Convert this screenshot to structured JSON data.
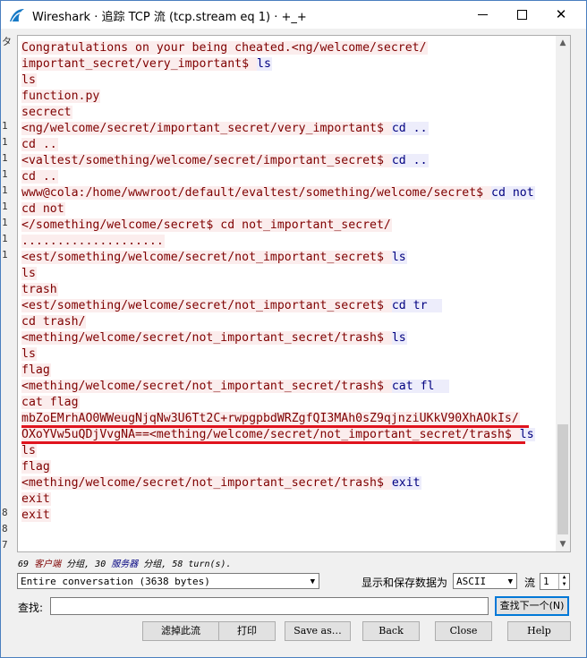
{
  "window": {
    "title": "Wireshark · 追踪 TCP 流 (tcp.stream eq 1) · +_+",
    "controls": {
      "minimize": "—",
      "maximize": "☐",
      "close": "✕"
    }
  },
  "left_strip": [
    "タ",
    "1",
    "1",
    "1",
    "1",
    "1",
    "1",
    "1",
    "1",
    "1",
    "8",
    "8",
    "7"
  ],
  "stream_lines": [
    [
      {
        "t": "Congratulations on your being cheated.<ng/welcome/secret/",
        "k": "c"
      }
    ],
    [
      {
        "t": "important_secret/very_important$ ",
        "k": "c"
      },
      {
        "t": "ls",
        "k": "s"
      }
    ],
    [
      {
        "t": "ls",
        "k": "c"
      }
    ],
    [
      {
        "t": "function.py",
        "k": "c"
      }
    ],
    [
      {
        "t": "secrect",
        "k": "c"
      }
    ],
    [
      {
        "t": "<ng/welcome/secret/important_secret/very_important$ ",
        "k": "c"
      },
      {
        "t": "cd ..",
        "k": "s"
      }
    ],
    [
      {
        "t": "cd ..",
        "k": "c"
      }
    ],
    [
      {
        "t": "<valtest/something/welcome/secret/important_secret$ ",
        "k": "c"
      },
      {
        "t": "cd ..",
        "k": "s"
      }
    ],
    [
      {
        "t": "cd ..",
        "k": "c"
      }
    ],
    [
      {
        "t": "www@cola:/home/wwwroot/default/evaltest/something/welcome/secret$ ",
        "k": "c"
      },
      {
        "t": "cd not",
        "k": "s"
      }
    ],
    [
      {
        "t": "cd not",
        "k": "c"
      }
    ],
    [
      {
        "t": "</something/welcome/secret$ cd not_important_secret/",
        "k": "c"
      }
    ],
    [
      {
        "t": "....................",
        "k": "c"
      }
    ],
    [
      {
        "t": "<est/something/welcome/secret/not_important_secret$ ",
        "k": "c"
      },
      {
        "t": "ls",
        "k": "s"
      }
    ],
    [
      {
        "t": "ls",
        "k": "c"
      }
    ],
    [
      {
        "t": "trash",
        "k": "c"
      }
    ],
    [
      {
        "t": "<est/something/welcome/secret/not_important_secret$ ",
        "k": "c"
      },
      {
        "t": "cd tr  ",
        "k": "s"
      }
    ],
    [
      {
        "t": "cd trash/",
        "k": "c"
      }
    ],
    [
      {
        "t": "<mething/welcome/secret/not_important_secret/trash$ ",
        "k": "c"
      },
      {
        "t": "ls",
        "k": "s"
      }
    ],
    [
      {
        "t": "ls",
        "k": "c"
      }
    ],
    [
      {
        "t": "flag",
        "k": "c"
      }
    ],
    [
      {
        "t": "<mething/welcome/secret/not_important_secret/trash$ ",
        "k": "c"
      },
      {
        "t": "cat fl  ",
        "k": "s"
      }
    ],
    [
      {
        "t": "cat flag",
        "k": "c"
      }
    ],
    [
      {
        "t": "mbZoEMrhAO0WWeugNjqNw3U6Tt2C+rwpgpbdWRZgfQI3MAh0sZ9qjnziUKkV90XhAOkIs/",
        "k": "c"
      }
    ],
    [
      {
        "t": "OXoYVw5uQDjVvgNA==<mething/welcome/secret/not_important_secret/trash$ ",
        "k": "c"
      },
      {
        "t": "ls",
        "k": "s"
      }
    ],
    [
      {
        "t": "ls",
        "k": "c"
      }
    ],
    [
      {
        "t": "flag",
        "k": "c"
      }
    ],
    [
      {
        "t": "<mething/welcome/secret/not_important_secret/trash$ ",
        "k": "c"
      },
      {
        "t": "exit",
        "k": "s"
      }
    ],
    [
      {
        "t": "exit",
        "k": "c"
      }
    ],
    [
      {
        "t": "exit",
        "k": "c"
      }
    ]
  ],
  "stats": {
    "client_count": "69",
    "client_label": "客户端",
    "client_suffix": "分组,",
    "server_count": "30",
    "server_label": "服务器",
    "server_suffix": "分组,",
    "turns": "58 turn(s)."
  },
  "conversation_select": {
    "value": "Entire conversation (3638 bytes)"
  },
  "show_save_label": "显示和保存数据为",
  "encoding_select": {
    "value": "ASCII"
  },
  "stream_label": "流",
  "stream_value": "1",
  "find": {
    "label": "查找:",
    "value": "",
    "next_button": "查找下一个(N)"
  },
  "buttons": {
    "filter_out": "滤掉此流",
    "print": "打印",
    "save_as": "Save as…",
    "back": "Back",
    "close": "Close",
    "help": "Help"
  },
  "colors": {
    "client_text": "#7f0000",
    "client_bg": "#fbeded",
    "server_text": "#000080",
    "server_bg": "#ededfb",
    "annotation": "#e0141e"
  }
}
